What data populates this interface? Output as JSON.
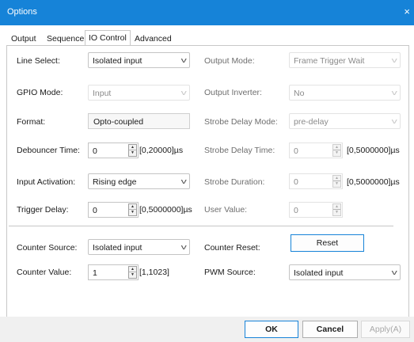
{
  "window": {
    "title": "Options",
    "close_glyph": "×"
  },
  "tabs": [
    {
      "label": "Output"
    },
    {
      "label": "Sequence"
    },
    {
      "label": "IO Control",
      "active": true
    },
    {
      "label": "Advanced"
    }
  ],
  "io": {
    "line_select": {
      "label": "Line Select:",
      "value": "Isolated input"
    },
    "gpio_mode": {
      "label": "GPIO Mode:",
      "value": "Input"
    },
    "format": {
      "label": "Format:",
      "value": "Opto-coupled"
    },
    "debouncer_time": {
      "label": "Debouncer Time:",
      "value": "0",
      "range": "[0,20000]µs"
    },
    "input_activation": {
      "label": "Input Activation:",
      "value": "Rising edge"
    },
    "trigger_delay": {
      "label": "Trigger Delay:",
      "value": "0",
      "range": "[0,5000000]µs"
    },
    "output_mode": {
      "label": "Output Mode:",
      "value": "Frame Trigger Wait"
    },
    "output_inverter": {
      "label": "Output Inverter:",
      "value": "No"
    },
    "strobe_delay_mode": {
      "label": "Strobe Delay Mode:",
      "value": "pre-delay"
    },
    "strobe_delay_time": {
      "label": "Strobe Delay Time:",
      "value": "0",
      "range": "[0,5000000]µs"
    },
    "strobe_duration": {
      "label": "Strobe Duration:",
      "value": "0",
      "range": "[0,5000000]µs"
    },
    "user_value": {
      "label": "User Value:",
      "value": "0"
    }
  },
  "counter": {
    "source": {
      "label": "Counter Source:",
      "value": "Isolated input"
    },
    "value": {
      "label": "Counter Value:",
      "value": "1",
      "range": "[1,1023]"
    },
    "reset": {
      "label": "Counter Reset:",
      "button": "Reset"
    },
    "pwm_source": {
      "label": "PWM Source:",
      "value": "Isolated input"
    }
  },
  "footer": {
    "ok": "OK",
    "cancel": "Cancel",
    "apply": "Apply(A)"
  },
  "icons": {
    "dropdown": "chevron-down-icon",
    "spin_up": "spin-up-icon",
    "spin_down": "spin-down-icon",
    "close": "close-icon"
  },
  "colors": {
    "titlebar": "#1683d8",
    "focus_border": "#1683d8",
    "footer_bg": "#f0f0f0"
  }
}
